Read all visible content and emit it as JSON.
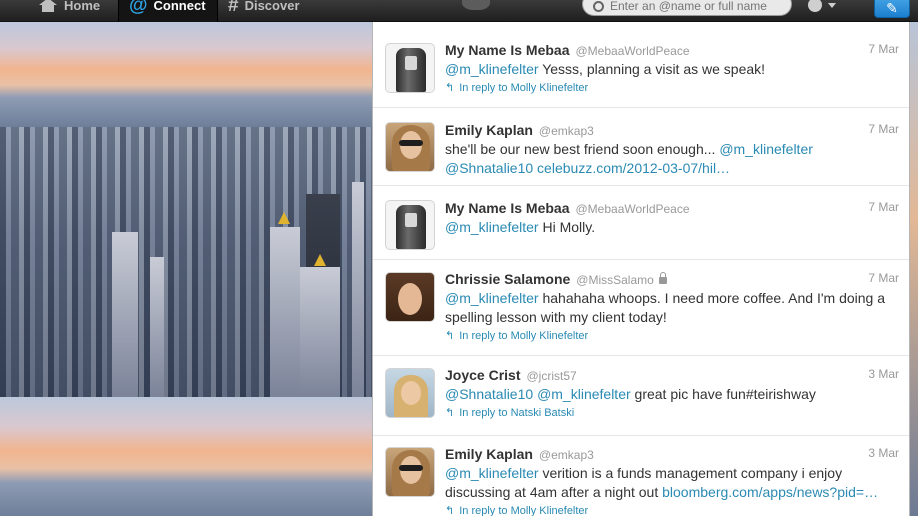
{
  "nav": {
    "home_label": "Home",
    "connect_label": "Connect",
    "discover_label": "Discover",
    "search_placeholder": "Enter an @name or full name"
  },
  "colors": {
    "accent": "#2a8ab3",
    "topbar": "#1f1f1f",
    "compose": "#1c7fcf"
  },
  "tweets": [
    {
      "name": "My Name Is Mebaa",
      "handle": "@MebaaWorldPeace",
      "date": "7 Mar",
      "mention": "@m_klinefelter",
      "text": " Yesss, planning a visit as we speak!",
      "reply_to": "In reply to Molly Klinefelter"
    },
    {
      "name": "Emily Kaplan",
      "handle": "@emkap3",
      "date": "7 Mar",
      "text_a": "she'll be our new best friend soon enough... ",
      "mention_a": "@m_klinefelter",
      "mention_b": "@Shnatalie10",
      "link": " celebuzz.com/2012-03-07/hil…"
    },
    {
      "name": "My Name Is Mebaa",
      "handle": "@MebaaWorldPeace",
      "date": "7 Mar",
      "mention": "@m_klinefelter",
      "text": " Hi Molly."
    },
    {
      "name": "Chrissie Salamone",
      "handle": "@MissSalamo",
      "date": "7 Mar",
      "mention": "@m_klinefelter",
      "text": " hahahaha whoops. I need more coffee. And I'm doing a spelling lesson with my client today!",
      "reply_to": "In reply to Molly Klinefelter"
    },
    {
      "name": "Joyce Crist",
      "handle": "@jcrist57",
      "date": "3 Mar",
      "mention_a": "@Shnatalie10",
      "mention_b": "@m_klinefelter",
      "text": " great pic have fun#teirishway",
      "reply_to": "In reply to Natski Batski"
    },
    {
      "name": "Emily Kaplan",
      "handle": "@emkap3",
      "date": "3 Mar",
      "mention": "@m_klinefelter",
      "text": " verition is a funds management company i enjoy discussing at 4am after a night out ",
      "link": "bloomberg.com/apps/news?pid=…",
      "reply_to": "In reply to Molly Klinefelter"
    }
  ]
}
